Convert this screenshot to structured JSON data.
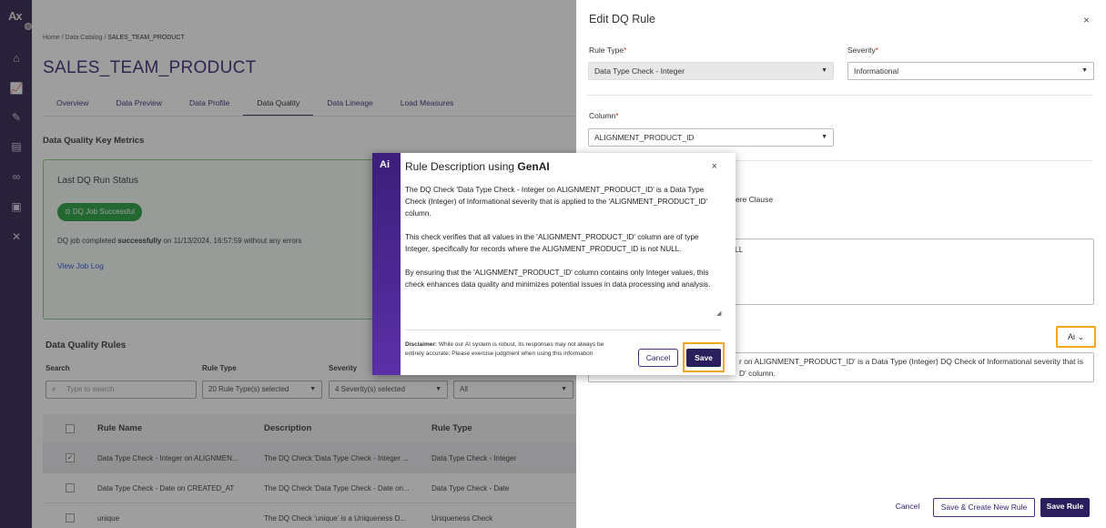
{
  "nav": {
    "logo": "Ax",
    "icons": [
      "home-icon",
      "chart-icon",
      "tools-icon",
      "document-icon",
      "link-icon",
      "briefcase-icon",
      "wrench-icon"
    ]
  },
  "breadcrumb": {
    "home": "Home",
    "sep1": "/",
    "catalog": "Data Catalog",
    "sep2": "/",
    "current": "SALES_TEAM_PRODUCT"
  },
  "page_title": "SALES_TEAM_PRODUCT",
  "tabs": [
    "Overview",
    "Data Preview",
    "Data Profile",
    "Data Quality",
    "Data Lineage",
    "Load Measures"
  ],
  "key_metrics": {
    "title": "Data Quality Key Metrics",
    "card_title": "Last DQ Run Status",
    "badge": "DQ Job Successful",
    "status_prefix": "DQ job completed ",
    "status_bold": "successfully",
    "status_suffix": " on 11/13/2024, 16:57:59 without any errors",
    "link": "View Job Log"
  },
  "rules": {
    "title": "Data Quality Rules",
    "search_label": "Search",
    "search_placeholder": "Type to search",
    "rule_type_label": "Rule Type",
    "rule_type_value": "20 Rule Type(s) selected",
    "severity_label": "Severity",
    "severity_value": "4 Severity(s) selected",
    "status_value": "All",
    "columns": [
      "Rule Name",
      "Description",
      "Rule Type"
    ],
    "rows": [
      {
        "name": "Data Type Check - Integer on ALIGNMEN...",
        "desc": "The DQ Check 'Data Type Check - Integer ...",
        "type": "Data Type Check - Integer",
        "checked": "✓"
      },
      {
        "name": "Data Type Check - Date on CREATED_AT",
        "desc": "The DQ Check 'Data Type Check - Date on...",
        "type": "Data Type Check - Date",
        "checked": ""
      },
      {
        "name": "unique",
        "desc": "The DQ Check 'unique' is a Uniqueness D...",
        "type": "Uniqueness Check",
        "checked": ""
      }
    ]
  },
  "panel": {
    "title": "Edit DQ Rule",
    "close": "×",
    "rule_type_label": "Rule Type",
    "rule_type_value": "Data Type Check - Integer",
    "severity_label": "Severity",
    "severity_value": "Informational",
    "column_label": "Column",
    "column_value": "ALIGNMENT_PRODUCT_ID",
    "required_mark": "*",
    "where_text": "ere Clause",
    "where_value": "LL",
    "desc_text": "r on ALIGNMENT_PRODUCT_ID' is a Data Type (Integer) DQ Check of Informational severity that is",
    "desc_text2": "D' column.",
    "genai_btn": "Ai",
    "cancel": "Cancel",
    "save_create": "Save & Create New Rule",
    "save_rule": "Save Rule"
  },
  "modal": {
    "logo": "Ai",
    "title_prefix": "Rule Description using ",
    "title_bold": "GenAI",
    "close": "×",
    "p1": "The DQ Check 'Data Type Check - Integer on ALIGNMENT_PRODUCT_ID' is a Data Type Check (Integer) of Informational severity that is applied to the 'ALIGNMENT_PRODUCT_ID' column.",
    "p2": "This check verifies that all values in the 'ALIGNMENT_PRODUCT_ID' column are of type Integer, specifically for records where the ALIGNMENT_PRODUCT_ID is not NULL.",
    "p3": "By ensuring that the 'ALIGNMENT_PRODUCT_ID' column contains only Integer values, this check enhances data quality and minimizes potential issues in data processing and analysis.",
    "disclaimer_label": "Disclaimer:",
    "disclaimer_text": " While our AI system is robust, its responses may not always be entirely accurate. Please exercise judgment when using this information",
    "cancel": "Cancel",
    "save": "Save"
  },
  "colors": {
    "brand": "#2a1a4a",
    "accent": "#3a2470",
    "highlight": "#f2a516",
    "success": "#1f9c3a"
  }
}
